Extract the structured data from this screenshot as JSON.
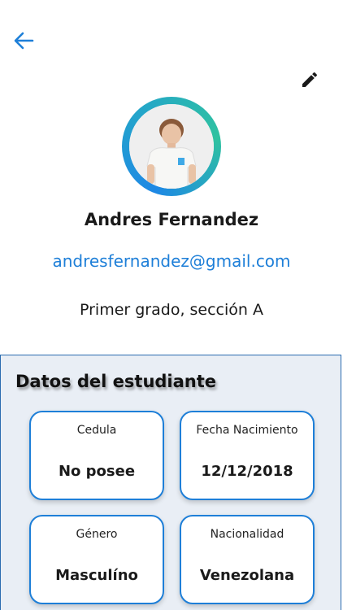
{
  "header": {
    "back_icon": "arrow-left-icon",
    "edit_icon": "pencil-icon"
  },
  "colors": {
    "accent": "#1e7fd8",
    "panel_background": "#e9eef5",
    "avatar_ring_start": "#1e88e5",
    "avatar_ring_end": "#2fc2a0"
  },
  "profile": {
    "name": "Andres Fernandez",
    "email": "andresfernandez@gmail.com",
    "grade": "Primer grado, sección A"
  },
  "student_data": {
    "title": "Datos del estudiante",
    "cards": [
      {
        "label": "Cedula",
        "value": "No posee"
      },
      {
        "label": "Fecha Nacimiento",
        "value": "12/12/2018"
      },
      {
        "label": "Género",
        "value": "Masculíno"
      },
      {
        "label": "Nacionalidad",
        "value": "Venezolana"
      }
    ]
  }
}
